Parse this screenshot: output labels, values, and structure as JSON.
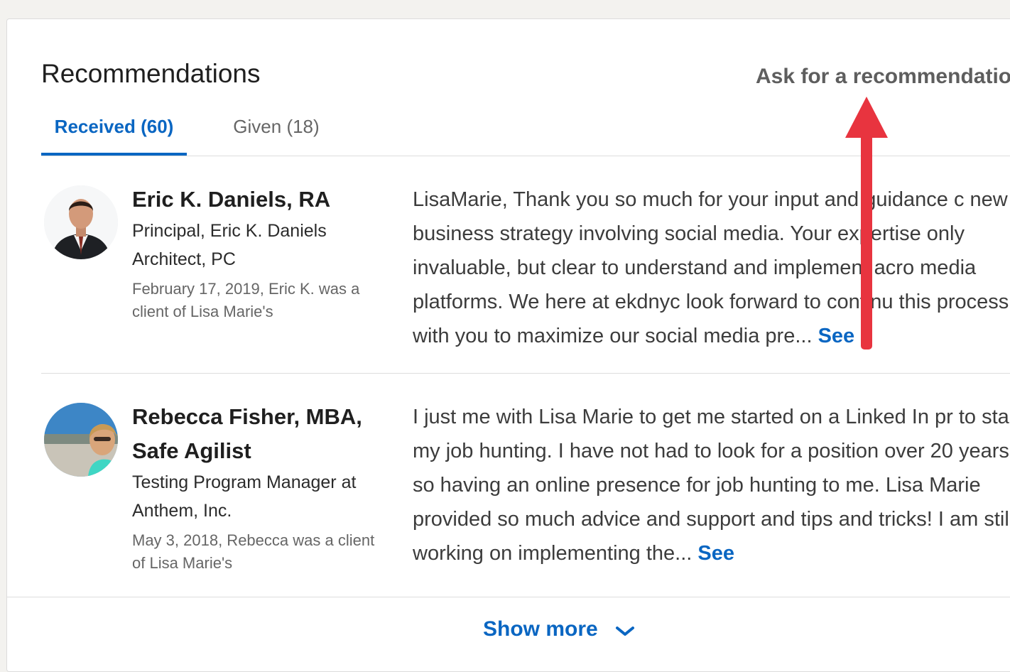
{
  "section": {
    "title": "Recommendations",
    "ask_link": "Ask for a recommendatio"
  },
  "tabs": [
    {
      "label": "Received (60)",
      "active": true
    },
    {
      "label": "Given (18)",
      "active": false
    }
  ],
  "recommendations": [
    {
      "name": "Eric K. Daniels, RA",
      "role": "Principal, Eric K. Daniels Architect, PC",
      "meta": "February 17, 2019, Eric K. was a client of Lisa Marie's",
      "text": "LisaMarie, Thank you so much for your input and guidance c new business strategy involving social media. Your expertise only invaluable, but clear to understand and implement acro media platforms. We here at ekdnyc look forward to continu this process with you to maximize our social media pre...",
      "see_more": "See"
    },
    {
      "name": "Rebecca Fisher, MBA, Safe Agilist",
      "role": "Testing Program Manager at Anthem, Inc.",
      "meta": "May 3, 2018, Rebecca was a client of Lisa Marie's",
      "text": "I just me with Lisa Marie to get me started on a Linked In pr to start my job hunting. I have not had to look for a position over 20 years, so having an online presence for job hunting to me. Lisa Marie provided so much advice and support and tips and tricks! I am still working on implementing the...",
      "see_more": "See"
    }
  ],
  "footer": {
    "show_more": "Show more"
  },
  "colors": {
    "accent": "#0a66c2",
    "annotation_arrow": "#e8343f"
  },
  "icons": {
    "show_more": "chevron-down-icon",
    "annotation": "red-arrow-icon"
  }
}
